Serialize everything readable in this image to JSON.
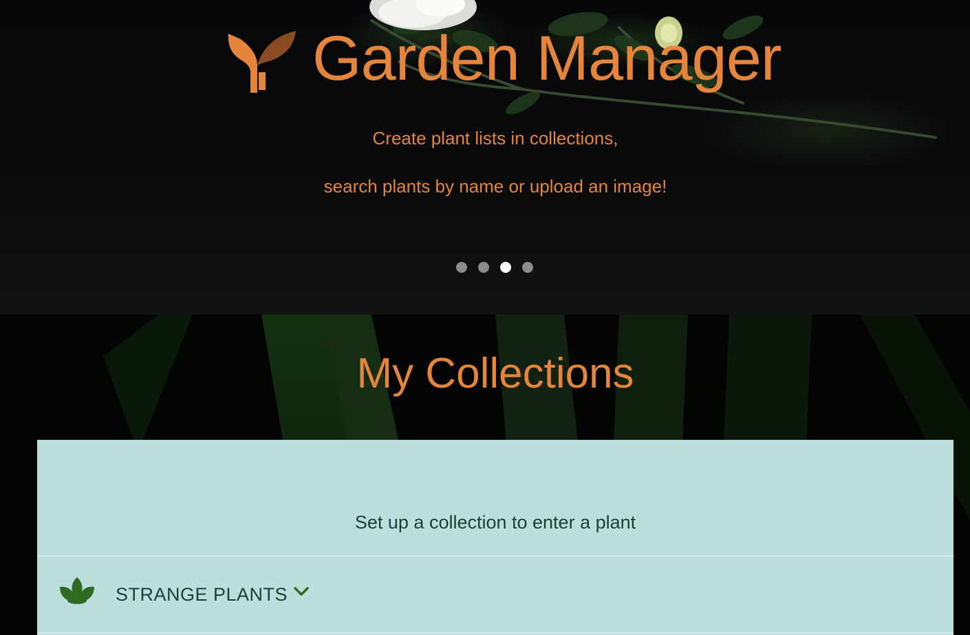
{
  "hero": {
    "title": "Garden Manager",
    "tagline_line1": "Create plant lists in collections,",
    "tagline_line2": "search plants by name or upload an image!",
    "carousel": {
      "slide_count": 4,
      "active_index": 2
    },
    "logo_icon": "sprout-logo-icon"
  },
  "collections": {
    "heading": "My Collections",
    "hint": "Set up a collection to enter a plant",
    "items": [
      {
        "label": "STRANGE PLANTS",
        "icon": "lotus-leaf-icon",
        "toggle_icon": "chevron-down-icon"
      }
    ]
  },
  "colors": {
    "accent": "#e5853c",
    "panel_bg": "#bcdfdc",
    "panel_text": "#1e3d36",
    "icon_green": "#2e6a22"
  }
}
